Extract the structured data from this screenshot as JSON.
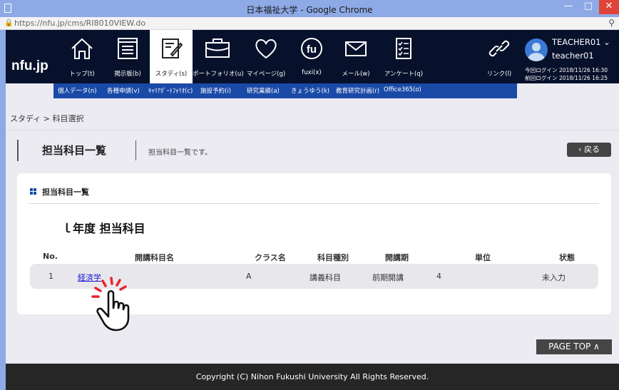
{
  "window": {
    "title": "日本福祉大学 - Google Chrome",
    "minimize": "—",
    "maximize": "□",
    "close": "✕"
  },
  "address": {
    "url": "https://nfu.jp/cms/RI8010VIEW.do",
    "lock_icon": "lock-icon",
    "zoom_icon": "zoom-icon"
  },
  "header": {
    "logo": "nfu.jp",
    "nav": [
      {
        "label": "トップ(t)",
        "icon": "home-icon"
      },
      {
        "label": "掲示板(b)",
        "icon": "bulletin-icon"
      },
      {
        "label": "スタディ(s)",
        "icon": "study-icon"
      },
      {
        "label": "ポートフォリオ(u)",
        "icon": "briefcase-icon"
      },
      {
        "label": "マイページ(g)",
        "icon": "heart-icon"
      },
      {
        "label": "fuxi(x)",
        "icon": "fu-icon"
      },
      {
        "label": "メール(w)",
        "icon": "mail-icon"
      },
      {
        "label": "アンケート(q)",
        "icon": "survey-icon"
      },
      {
        "label": "リンク(l)",
        "icon": "link-icon"
      }
    ],
    "user": {
      "name": "TEACHER01 ⌄",
      "id": "teacher01",
      "login_current": "今回ログイン 2018/11/26 16:30",
      "login_previous": "前回ログイン 2018/11/26 16:25"
    }
  },
  "subnav": [
    "個人データ(n)",
    "各種申請(v)",
    "ｷｬﾘｱﾎﾟｰﾄﾌｫﾘｵ(c)",
    "施設予約(i)",
    "研究業績(a)",
    "きょうゆう(k)",
    "教育研究計画(r)",
    "Office365(o)"
  ],
  "breadcrumb": "スタディ > 科目選択",
  "page": {
    "title": "担当科目一覧",
    "description": "担当科目一覧です。",
    "back": "‹ 戻る"
  },
  "card": {
    "title": "担当科目一覧",
    "year_title": "ｌ年度 担当科目",
    "columns": [
      "No.",
      "開講科目名",
      "クラス名",
      "科目種別",
      "開講期",
      "単位",
      "状態"
    ],
    "rows": [
      {
        "no": "1",
        "name": "経済学",
        "class": "A",
        "type": "講義科目",
        "period": "前期開講",
        "units": "4",
        "status": "未入力"
      }
    ]
  },
  "pagetop": "PAGE TOP ∧",
  "footer": "Copyright (C) Nihon Fukushi University All Rights Reserved."
}
